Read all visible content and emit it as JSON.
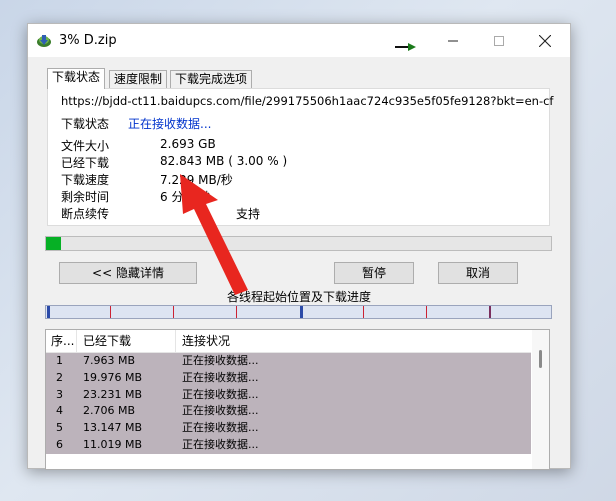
{
  "window": {
    "title": "3% D.zip",
    "icon": "idm-app-icon"
  },
  "tabs": [
    {
      "label": "下载状态",
      "active": true
    },
    {
      "label": "速度限制",
      "active": false
    },
    {
      "label": "下载完成选项",
      "active": false
    }
  ],
  "status": {
    "url": "https://bjdd-ct11.baidupcs.com/file/299175506h1aac724c935e5f05fe9128?bkt=en-cf",
    "status_label": "下载状态",
    "status_value": "正在接收数据...",
    "rows": [
      {
        "label": "文件大小",
        "value": "2.693  GB"
      },
      {
        "label": "已经下载",
        "value": "82.843  MB  ( 3.00 % )"
      },
      {
        "label": "下载速度",
        "value": "7.229  MB/秒"
      },
      {
        "label": "剩余时间",
        "value": "6 分 7 秒"
      },
      {
        "label": "断点续传",
        "value": "支持"
      }
    ]
  },
  "progress": {
    "percent": 3.0,
    "color": "#06b025"
  },
  "buttons": {
    "hide_details": "<< 隐藏详情",
    "pause": "暂停",
    "cancel": "取消"
  },
  "threads": {
    "caption": "各线程起始位置及下载进度",
    "columns": [
      "序...",
      "已经下载",
      "连接状况"
    ],
    "rows": [
      {
        "no": "1",
        "downloaded": "7.963 MB",
        "state": "正在接收数据..."
      },
      {
        "no": "2",
        "downloaded": "19.976 MB",
        "state": "正在接收数据..."
      },
      {
        "no": "3",
        "downloaded": "23.231 MB",
        "state": "正在接收数据..."
      },
      {
        "no": "4",
        "downloaded": "2.706 MB",
        "state": "正在接收数据..."
      },
      {
        "no": "5",
        "downloaded": "13.147 MB",
        "state": "正在接收数据..."
      },
      {
        "no": "6",
        "downloaded": "11.019 MB",
        "state": "正在接收数据..."
      }
    ]
  },
  "annotation": {
    "arrow_color": "#e8261f"
  }
}
